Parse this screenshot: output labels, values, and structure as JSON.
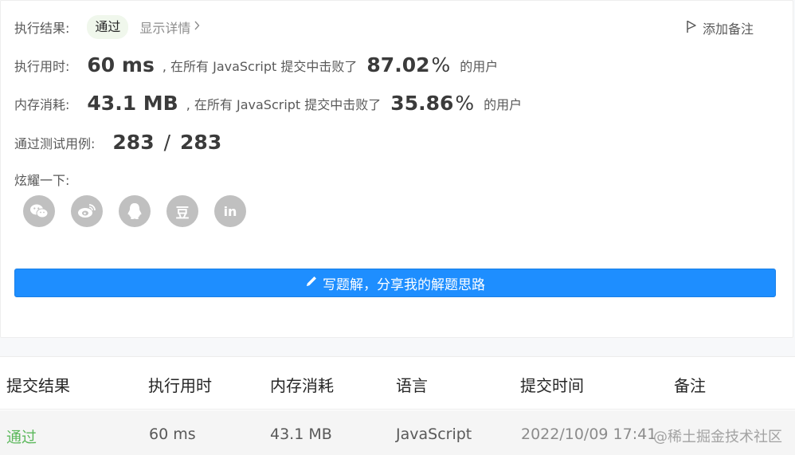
{
  "result": {
    "label": "执行结果:",
    "status": "通过",
    "details_label": "显示详情",
    "add_note_label": "添加备注"
  },
  "runtime": {
    "label": "执行用时:",
    "value": "60 ms",
    "middle_text": ", 在所有 JavaScript 提交中击败了",
    "percent_value": "87.02",
    "percent_sign": "%",
    "suffix": "的用户"
  },
  "memory": {
    "label": "内存消耗:",
    "value": "43.1 MB",
    "middle_text": ", 在所有 JavaScript 提交中击败了",
    "percent_value": "35.86",
    "percent_sign": "%",
    "suffix": "的用户"
  },
  "testcases": {
    "label": "通过测试用例:",
    "passed": "283",
    "separator": "/",
    "total": "283"
  },
  "share": {
    "label": "炫耀一下:",
    "icons": [
      "wechat-icon",
      "weibo-icon",
      "qq-icon",
      "douban-icon",
      "linkedin-icon"
    ],
    "douban_glyph": "豆",
    "linkedin_glyph": "in"
  },
  "solution_button": {
    "label": "写题解，分享我的解题思路",
    "color": "#1e8eff"
  },
  "table": {
    "headers": [
      "提交结果",
      "执行用时",
      "内存消耗",
      "语言",
      "提交时间",
      "备注"
    ],
    "rows": [
      {
        "result": "通过",
        "runtime": "60 ms",
        "memory": "43.1 MB",
        "language": "JavaScript",
        "time": "2022/10/09 17:41"
      }
    ]
  },
  "watermark": "@稀土掘金技术社区",
  "colors": {
    "pass_green": "#5cb85c",
    "badge_bg": "#f0f7ec",
    "icon_gray": "#c0c0c0"
  }
}
